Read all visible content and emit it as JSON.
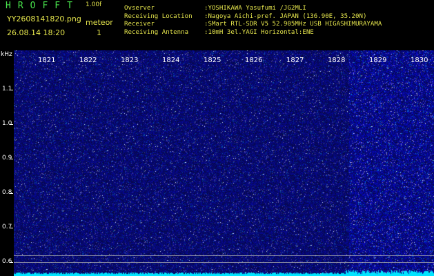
{
  "header": {
    "app_title": "HROFFT",
    "version": "1.00f",
    "filename": "YY2608141820.png",
    "datetime": "26.08.14 18:20",
    "meteor_label": "meteor",
    "meteor_count": "1"
  },
  "info": [
    {
      "key": "Ovserver",
      "value": ":YOSHIKAWA Yasufumi /JG2MLI"
    },
    {
      "key": "Receiving Location",
      "value": ":Nagoya Aichi-pref. JAPAN (136.90E, 35.20N)"
    },
    {
      "key": "Receiver",
      "value": ":SMart RTL-SDR V5 52.905MHz USB HIGASHIMURAYAMA"
    },
    {
      "key": "Receiving Antenna",
      "value": ":10mH 3el.YAGI Horizontal:ENE"
    }
  ],
  "axis": {
    "y_unit": "kHz",
    "y_ticks": [
      "1.1",
      "1.0",
      "0.9",
      "0.8",
      "0.7",
      "0.6"
    ],
    "x_ticks": [
      "1821",
      "1822",
      "1823",
      "1824",
      "1825",
      "1826",
      "1827",
      "1828",
      "1829",
      "1830"
    ]
  },
  "colors": {
    "background": "#000000",
    "plot_bg": "#0a0a55",
    "noise": "#3a3aff",
    "baseline": "#00e5ff",
    "title_green": "#49e64d",
    "text_yellow": "#e6e64d"
  }
}
